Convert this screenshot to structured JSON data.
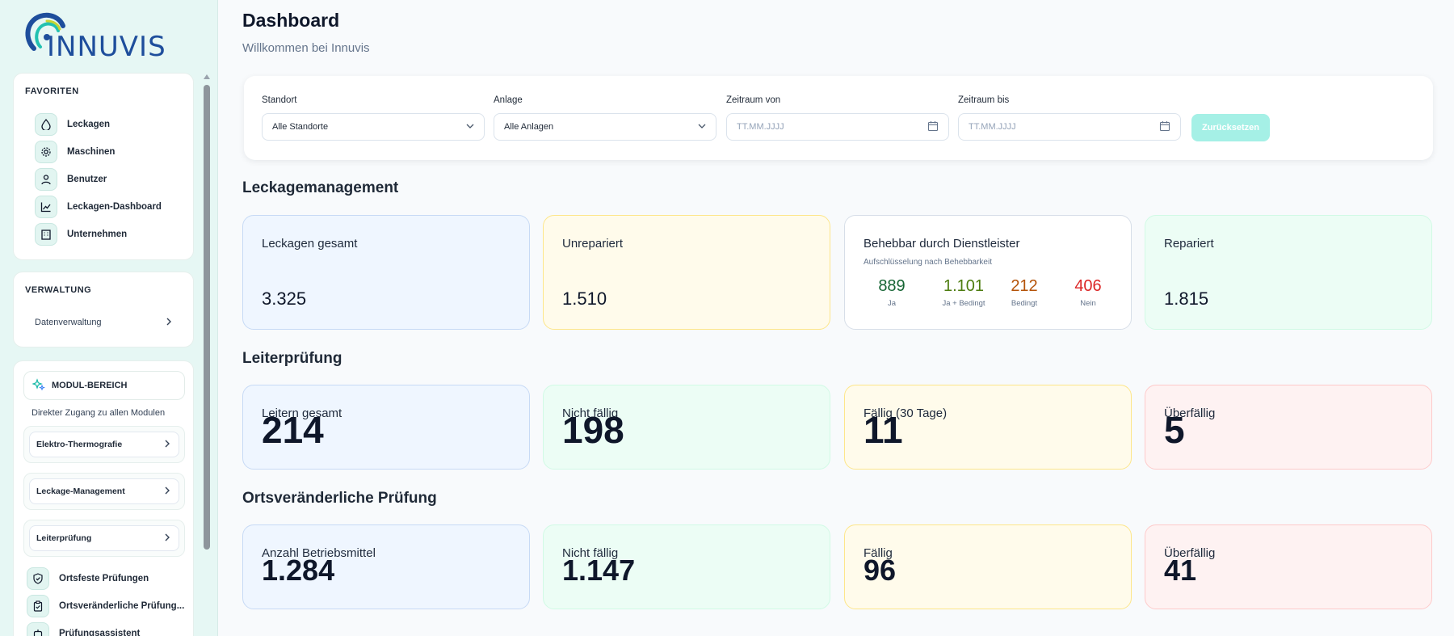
{
  "brand": {
    "name": "INNUVIS"
  },
  "sidebar": {
    "favorites": {
      "title": "FAVORITEN",
      "items": [
        {
          "label": "Leckagen",
          "icon": "drop-icon"
        },
        {
          "label": "Maschinen",
          "icon": "gear-icon"
        },
        {
          "label": "Benutzer",
          "icon": "user-icon"
        },
        {
          "label": "Leckagen-Dashboard",
          "icon": "chart-line-icon"
        },
        {
          "label": "Unternehmen",
          "icon": "building-icon"
        }
      ]
    },
    "verwaltung": {
      "title": "VERWALTUNG",
      "items": [
        {
          "label": "Datenverwaltung"
        }
      ]
    },
    "modules": {
      "title": "MODUL-BEREICH",
      "subtitle": "Direkter Zugang zu allen Modulen",
      "links": [
        {
          "label": "Elektro-Thermografie"
        },
        {
          "label": "Leckage-Management"
        },
        {
          "label": "Leiterprüfung"
        }
      ],
      "items": [
        {
          "label": "Ortsfeste Prüfungen",
          "icon": "shield-check-icon"
        },
        {
          "label": "Ortsveränderliche Prüfung...",
          "icon": "clipboard-check-icon"
        },
        {
          "label": "Prüfungsassistent",
          "icon": "robot-icon"
        }
      ]
    }
  },
  "header": {
    "title": "Dashboard",
    "subtitle": "Willkommen bei Innuvis"
  },
  "filters": {
    "standort": {
      "label": "Standort",
      "value": "Alle Standorte"
    },
    "anlage": {
      "label": "Anlage",
      "value": "Alle Anlagen"
    },
    "von": {
      "label": "Zeitraum von",
      "placeholder": "TT.MM.JJJJ"
    },
    "bis": {
      "label": "Zeitraum bis",
      "placeholder": "TT.MM.JJJJ"
    },
    "reset_label": "Zurücksetzen"
  },
  "leckagemanagement": {
    "title": "Leckagemanagement",
    "gesamt": {
      "label": "Leckagen gesamt",
      "value": "3.325"
    },
    "unrepariert": {
      "label": "Unrepariert",
      "value": "1.510"
    },
    "behebbar": {
      "label": "Behebbar durch Dienstleister",
      "sub": "Aufschlüsselung nach Behebbarkeit",
      "breakdown": [
        {
          "value": "889",
          "label": "Ja",
          "color": "#166534"
        },
        {
          "value": "1.101",
          "label": "Ja + Bedingt",
          "color": "#4d7c0f"
        },
        {
          "value": "212",
          "label": "Bedingt",
          "color": "#b45309"
        },
        {
          "value": "406",
          "label": "Nein",
          "color": "#dc2626"
        }
      ]
    },
    "repariert": {
      "label": "Repariert",
      "value": "1.815"
    }
  },
  "leiterpruefung": {
    "title": "Leiterprüfung",
    "cards": [
      {
        "label": "Leitern gesamt",
        "value": "214"
      },
      {
        "label": "Nicht fällig",
        "value": "198"
      },
      {
        "label": "Fällig (30 Tage)",
        "value": "11"
      },
      {
        "label": "Überfällig",
        "value": "5"
      }
    ]
  },
  "ortsveraenderlich": {
    "title": "Ortsveränderliche Prüfung",
    "cards": [
      {
        "label": "Anzahl Betriebsmittel",
        "value": "1.284"
      },
      {
        "label": "Nicht fällig",
        "value": "1.147"
      },
      {
        "label": "Fällig",
        "value": "96"
      },
      {
        "label": "Überfällig",
        "value": "41"
      }
    ]
  }
}
